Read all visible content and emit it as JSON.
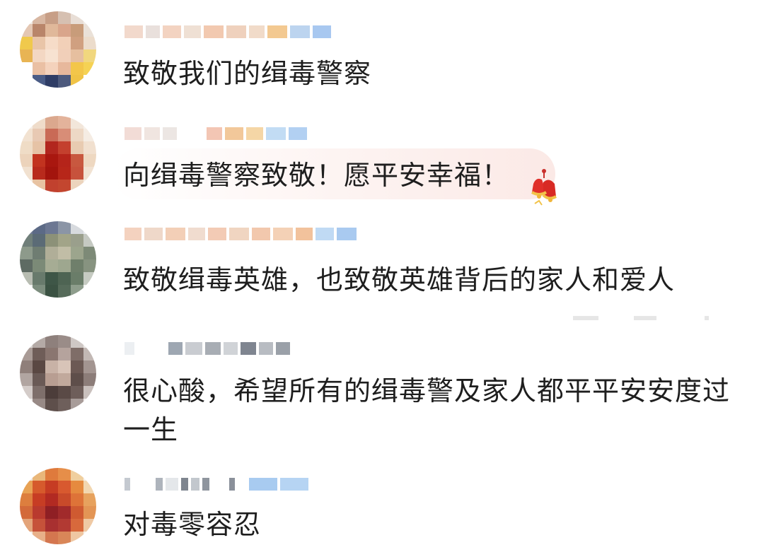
{
  "comments": [
    {
      "text": "致敬我们的缉毒警察"
    },
    {
      "text": "向缉毒警察致敬！愿平安幸福！",
      "decoration": "bell-icon"
    },
    {
      "text": "致敬缉毒英雄，也致敬英雄背后的家人和爱人"
    },
    {
      "text_line1": "很心酸，希望所有的缉毒警及家人都平平安安度过",
      "text_line2": "一生"
    },
    {
      "text": "对毒零容忍"
    }
  ],
  "colors": {
    "text": "#1e1e1e",
    "bubble": "#fbe9e6",
    "name_accent": "#9fc6f0"
  }
}
